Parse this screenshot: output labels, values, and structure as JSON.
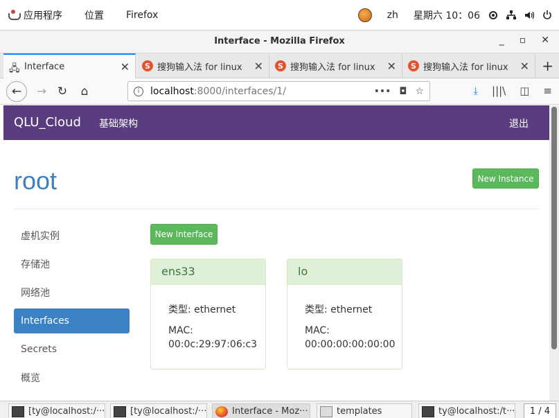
{
  "topbar": {
    "applications": "应用程序",
    "places": "位置",
    "app_name": "Firefox",
    "lang": "zh",
    "clock": "星期六 10：06"
  },
  "window": {
    "title": "Interface - Mozilla Firefox"
  },
  "tabs": [
    {
      "label": "Interface",
      "active": true
    },
    {
      "label": "搜狗输入法 for linux",
      "active": false
    },
    {
      "label": "搜狗输入法 for linux",
      "active": false
    },
    {
      "label": "搜狗输入法 for linux",
      "active": false
    }
  ],
  "urlbar": {
    "host": "localhost",
    "path": ":8000/interfaces/1/"
  },
  "site": {
    "brand": "QLU_Cloud",
    "menu_infra": "基础架构",
    "logout": "退出",
    "page_title": "root",
    "new_instance": "New Instance",
    "new_interface": "New Interface",
    "sidebar": [
      {
        "label": "虚机实例",
        "active": false
      },
      {
        "label": "存储池",
        "active": false
      },
      {
        "label": "网络池",
        "active": false
      },
      {
        "label": "Interfaces",
        "active": true
      },
      {
        "label": "Secrets",
        "active": false
      },
      {
        "label": "概览",
        "active": false
      }
    ],
    "interfaces": [
      {
        "name": "ens33",
        "type_label": "类型: ethernet",
        "mac_label": "MAC:",
        "mac": "00:0c:29:97:06:c3"
      },
      {
        "name": "lo",
        "type_label": "类型: ethernet",
        "mac_label": "MAC:",
        "mac": "00:00:00:00:00:00"
      }
    ]
  },
  "taskbar": {
    "tasks": [
      {
        "label": "[ty@localhost:/···",
        "icon": "terminal-icon",
        "active": false
      },
      {
        "label": "[ty@localhost:/···",
        "icon": "terminal-icon",
        "active": false
      },
      {
        "label": "Interface - Moz···",
        "icon": "firefox-icon",
        "active": true
      },
      {
        "label": "templates",
        "icon": "folder-icon",
        "active": false
      },
      {
        "label": "ty@localhost:/t···",
        "icon": "terminal-icon",
        "active": false
      }
    ],
    "pager": "1 / 4"
  }
}
